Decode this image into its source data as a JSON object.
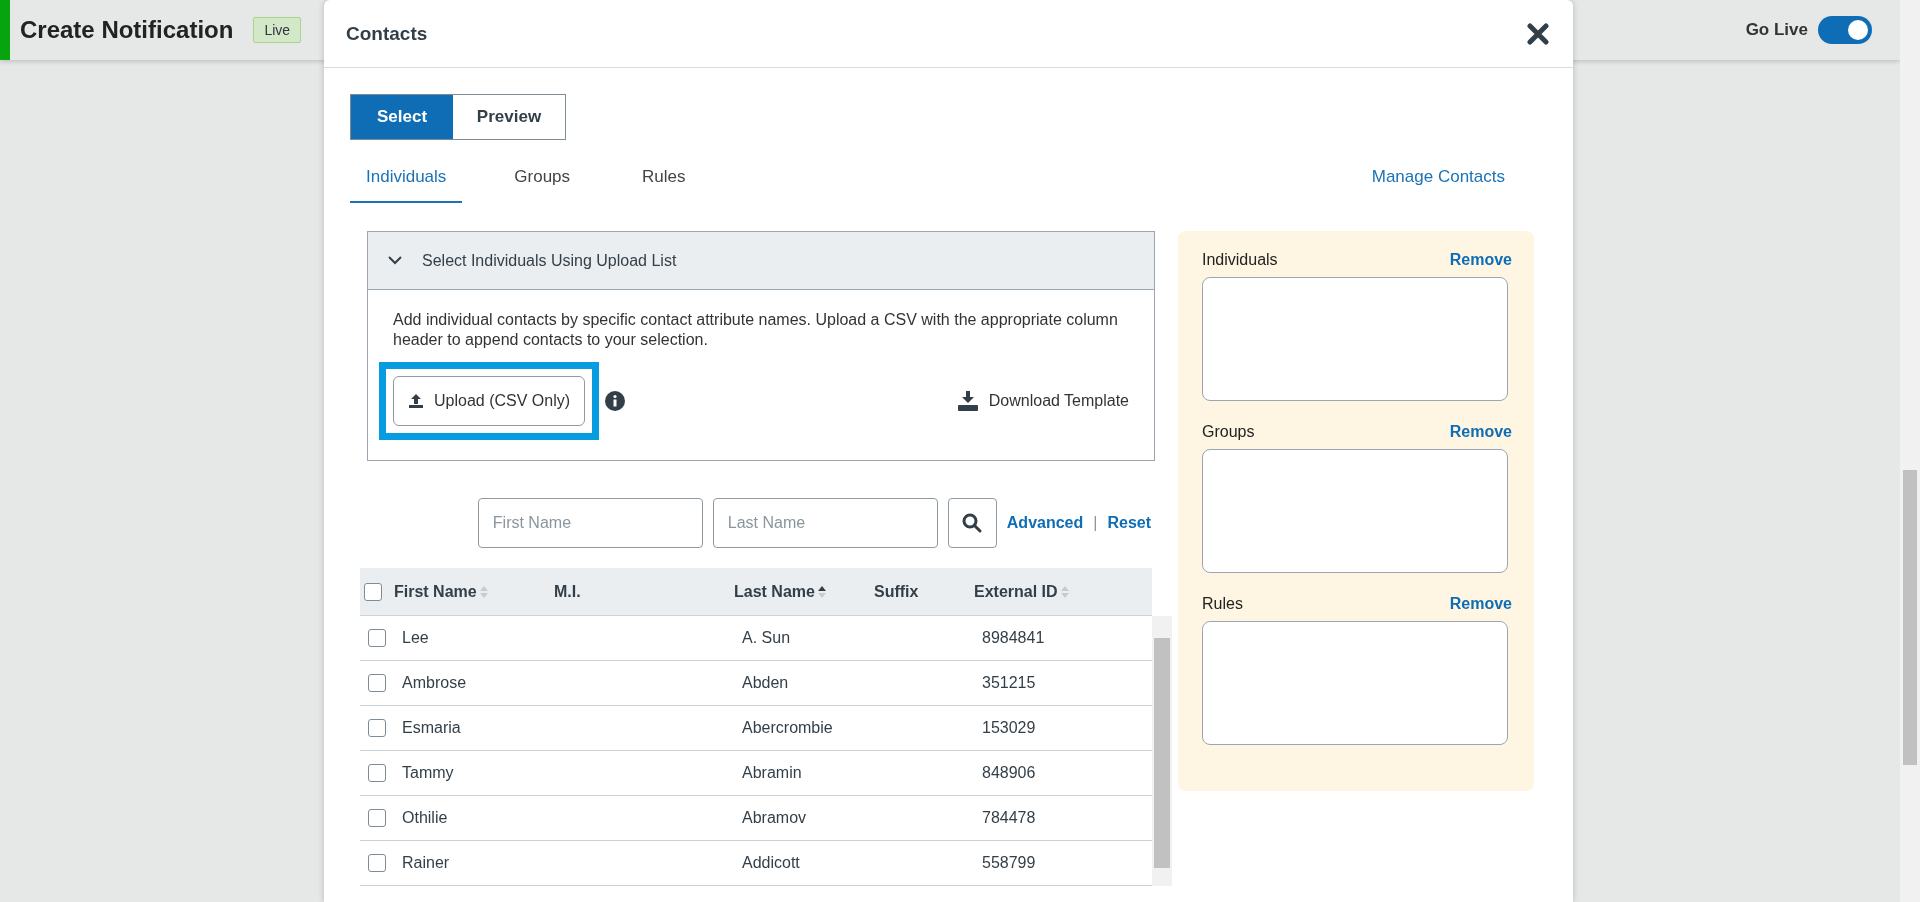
{
  "page": {
    "title": "Create Notification",
    "status_badge": "Live",
    "go_live": {
      "label": "Go Live",
      "on": true
    }
  },
  "dialog": {
    "title": "Contacts",
    "modes": [
      {
        "label": "Select",
        "selected": true
      },
      {
        "label": "Preview",
        "selected": false
      }
    ],
    "tabs": [
      {
        "label": "Individuals",
        "selected": true
      },
      {
        "label": "Groups",
        "selected": false
      },
      {
        "label": "Rules",
        "selected": false
      }
    ],
    "manage_link": "Manage Contacts",
    "upload_section": {
      "title": "Select Individuals Using Upload List",
      "expanded": true,
      "description": "Add individual contacts by specific contact attribute names. Upload a CSV with the appropriate column header to append contacts to your selection.",
      "upload_button": {
        "label": "Upload (CSV Only)",
        "highlighted": true
      },
      "download_link": "Download Template"
    },
    "search": {
      "first_name": {
        "placeholder": "First Name"
      },
      "last_name": {
        "placeholder": "Last Name"
      },
      "advanced": "Advanced",
      "separator": "|",
      "reset": "Reset"
    },
    "table": {
      "all_checked": false,
      "columns": [
        {
          "label": "First Name",
          "sortable": true,
          "sorted_ascending": false
        },
        {
          "label": "M.I.",
          "sortable": false
        },
        {
          "label": "Last Name",
          "sortable": true,
          "sorted_ascending": true
        },
        {
          "label": "Suffix",
          "sortable": false
        },
        {
          "label": "External ID",
          "sortable": true,
          "sorted_ascending": false
        }
      ],
      "rows": [
        {
          "checked": false,
          "cells": [
            "Lee",
            "",
            "A. Sun",
            "",
            "8984841"
          ]
        },
        {
          "checked": false,
          "cells": [
            "Ambrose",
            "",
            "Abden",
            "",
            "351215"
          ]
        },
        {
          "checked": false,
          "cells": [
            "Esmaria",
            "",
            "Abercrombie",
            "",
            "153029"
          ]
        },
        {
          "checked": false,
          "cells": [
            "Tammy",
            "",
            "Abramin",
            "",
            "848906"
          ]
        },
        {
          "checked": false,
          "cells": [
            "Othilie",
            "",
            "Abramov",
            "",
            "784478"
          ]
        },
        {
          "checked": false,
          "cells": [
            "Rainer",
            "",
            "Addicott",
            "",
            "558799"
          ]
        }
      ]
    },
    "selection": [
      {
        "label": "Individuals",
        "action": "Remove"
      },
      {
        "label": "Groups",
        "action": "Remove"
      },
      {
        "label": "Rules",
        "action": "Remove"
      }
    ]
  }
}
